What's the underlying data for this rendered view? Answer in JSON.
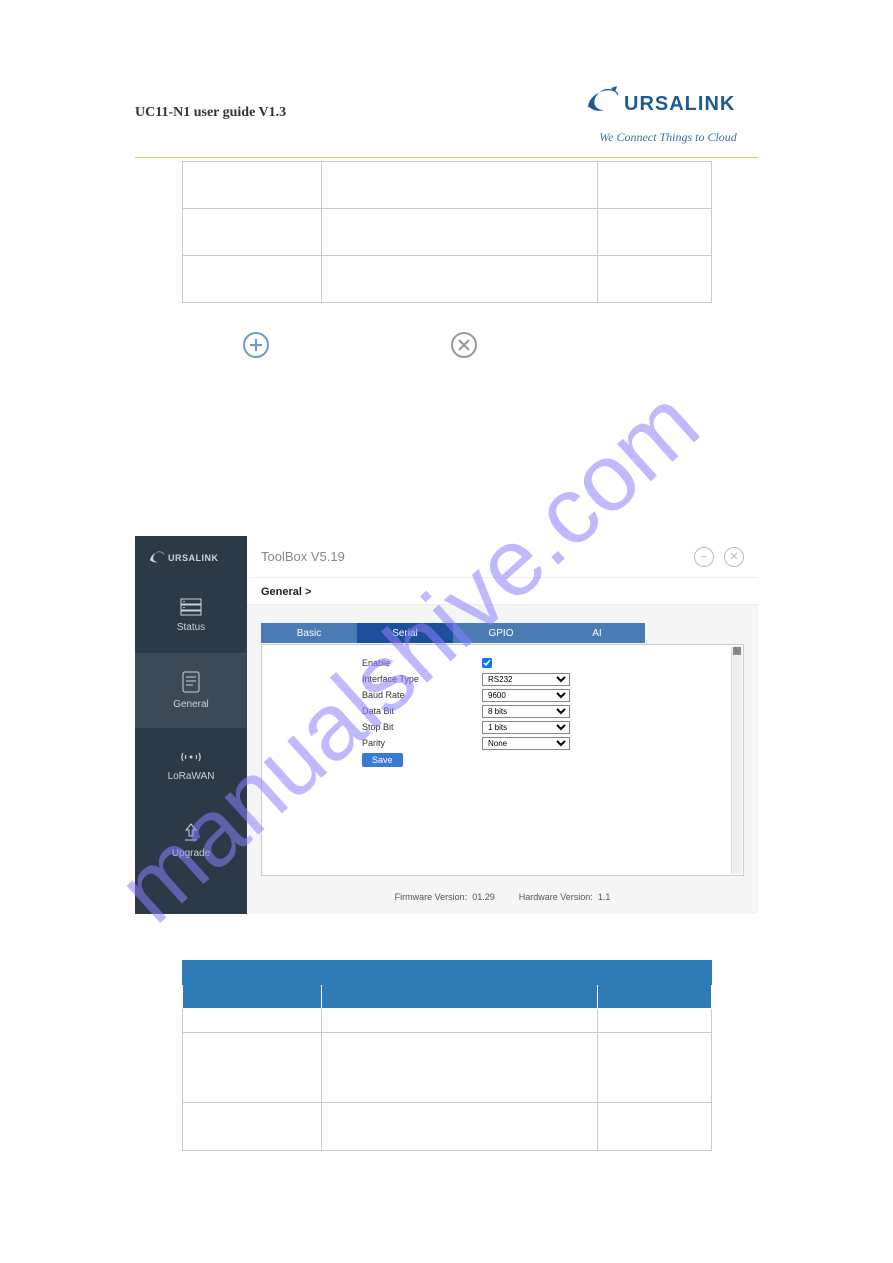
{
  "doc": {
    "title": "UC11-N1 user guide V1.3",
    "brand": "URSALINK",
    "tagline": "We Connect Things to Cloud"
  },
  "watermark_text": "manualshive.com",
  "icons": {
    "plus": "plus-circle-icon",
    "close": "close-circle-icon"
  },
  "app": {
    "toolbox_title": "ToolBox V5.19",
    "sidebar_brand": "URSALINK",
    "sidebar": {
      "items": [
        {
          "label": "Status",
          "icon": "server-icon"
        },
        {
          "label": "General",
          "icon": "document-icon"
        },
        {
          "label": "LoRaWAN",
          "icon": "antenna-icon"
        },
        {
          "label": "Upgrade",
          "icon": "upgrade-icon"
        }
      ]
    },
    "breadcrumb": "General >",
    "tabs": [
      {
        "label": "Basic"
      },
      {
        "label": "Serial"
      },
      {
        "label": "GPIO"
      },
      {
        "label": "AI"
      }
    ],
    "form": {
      "enable_label": "Enable",
      "enable_checked": true,
      "interface_type_label": "Interface Type",
      "interface_type_value": "RS232",
      "baud_rate_label": "Baud Rate",
      "baud_rate_value": "9600",
      "data_bit_label": "Data Bit",
      "data_bit_value": "8 bits",
      "stop_bit_label": "Stop Bit",
      "stop_bit_value": "1 bits",
      "parity_label": "Parity",
      "parity_value": "None",
      "save_label": "Save"
    },
    "footer": {
      "fw_label": "Firmware Version:",
      "fw_value": "01.29",
      "hw_label": "Hardware Version:",
      "hw_value": "1.1"
    },
    "top_icons": {
      "minimize": "minimize-icon",
      "close": "close-icon"
    }
  }
}
